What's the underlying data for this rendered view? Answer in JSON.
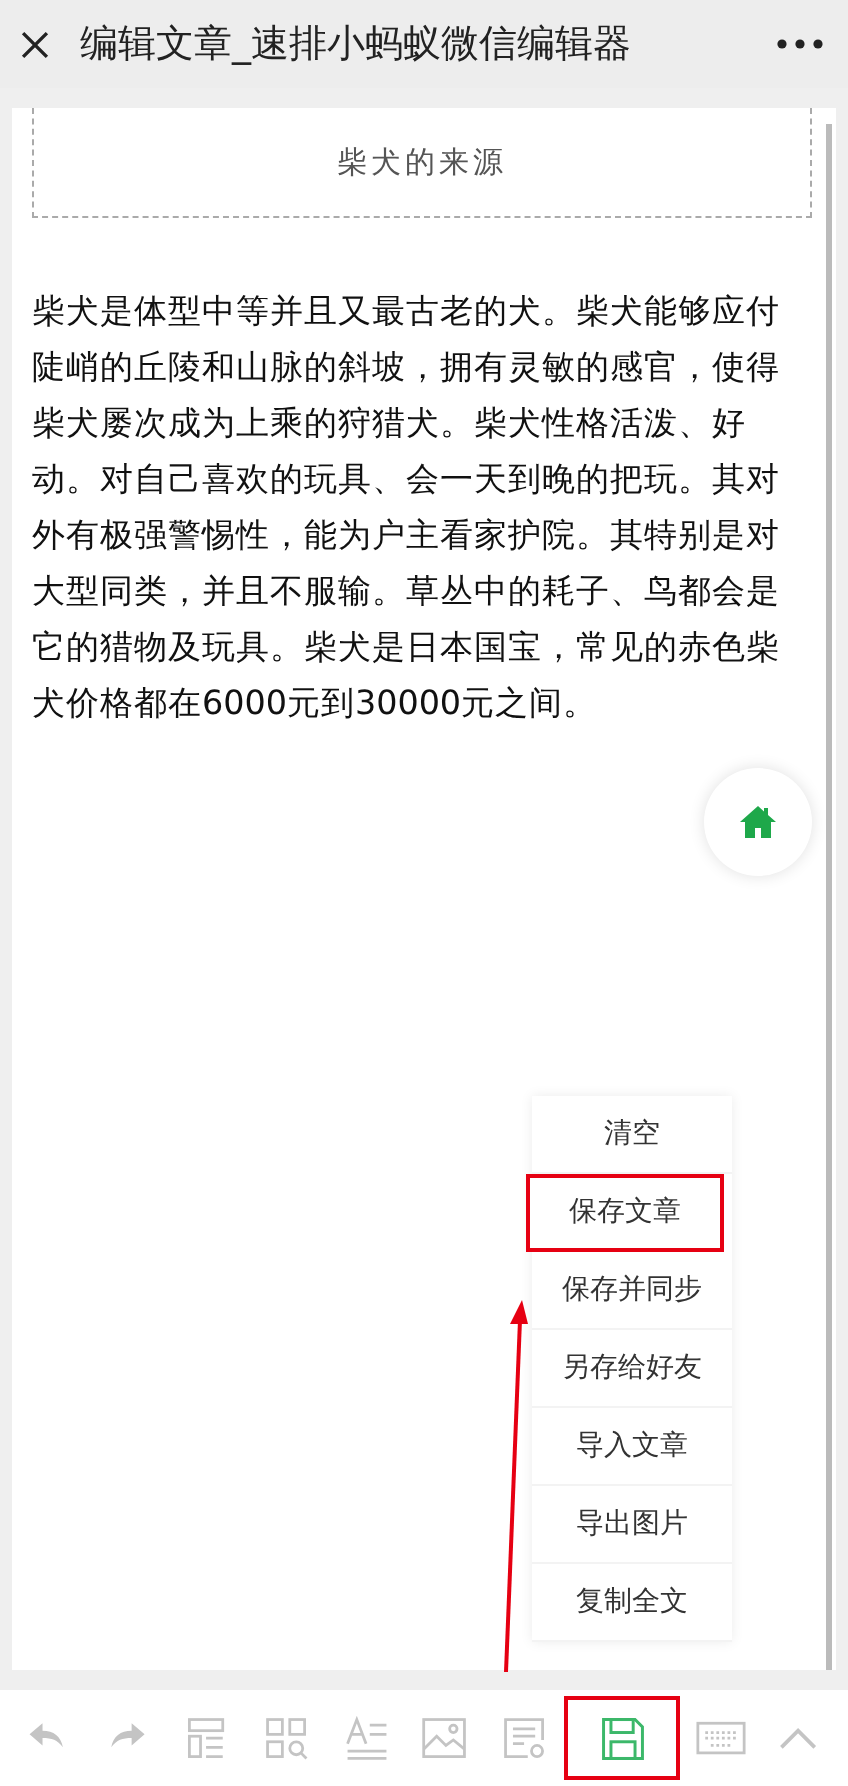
{
  "header": {
    "title": "编辑文章_速排小蚂蚁微信编辑器"
  },
  "article": {
    "heading": "柴犬的来源",
    "body": "柴犬是体型中等并且又最古老的犬。柴犬能够应付陡峭的丘陵和山脉的斜坡，拥有灵敏的感官，使得柴犬屡次成为上乘的狩猎犬。柴犬性格活泼、好动。对自己喜欢的玩具、会一天到晚的把玩。其对外有极强警惕性，能为户主看家护院。其特别是对大型同类，并且不服输。草丛中的耗子、鸟都会是它的猎物及玩具。柴犬是日本国宝，常见的赤色柴犬价格都在6000元到30000元之间。"
  },
  "menu": [
    {
      "label": "清空",
      "highlighted": false
    },
    {
      "label": "保存文章",
      "highlighted": true
    },
    {
      "label": "保存并同步",
      "highlighted": false
    },
    {
      "label": "另存给好友",
      "highlighted": false
    },
    {
      "label": "导入文章",
      "highlighted": false
    },
    {
      "label": "导出图片",
      "highlighted": false
    },
    {
      "label": "复制全文",
      "highlighted": false
    }
  ],
  "toolbar": [
    {
      "kind": "undo",
      "selected": false,
      "highlighted": false
    },
    {
      "kind": "redo",
      "selected": false,
      "highlighted": false
    },
    {
      "kind": "layout",
      "selected": false,
      "highlighted": false
    },
    {
      "kind": "templates",
      "selected": false,
      "highlighted": false
    },
    {
      "kind": "text",
      "selected": false,
      "highlighted": false
    },
    {
      "kind": "image",
      "selected": false,
      "highlighted": false
    },
    {
      "kind": "settings",
      "selected": false,
      "highlighted": false
    },
    {
      "kind": "save",
      "selected": true,
      "highlighted": true
    },
    {
      "kind": "keyboard",
      "selected": false,
      "highlighted": false
    },
    {
      "kind": "collapse",
      "selected": false,
      "highlighted": false
    }
  ]
}
